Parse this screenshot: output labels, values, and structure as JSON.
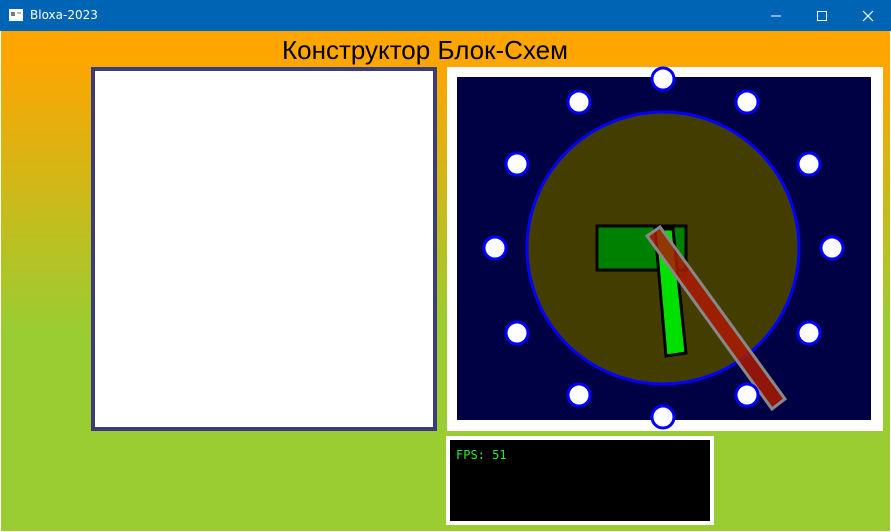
{
  "window": {
    "title": "Bloxa-2023",
    "titlebar_color": "#0064b4",
    "controls": [
      "minimize-icon",
      "maximize-icon",
      "close-icon"
    ]
  },
  "app": {
    "heading": "Конструктор Блок-Схем",
    "background_top_color": "#ffa500",
    "background_bottom_color": "#9acd32"
  },
  "block_panel": {
    "background_color": "#ffffff",
    "border_color": "#3c3c78"
  },
  "scene": {
    "background_color": "#000044",
    "circle_fill": "#443d00",
    "circle_stroke": "#0000ff",
    "handle_count": 12,
    "handle_fill": "#ffffff",
    "handle_stroke": "#0000ff",
    "blocks": [
      {
        "name": "dark-green-block",
        "color": "#008000"
      },
      {
        "name": "light-green-block",
        "color": "#00e000"
      },
      {
        "name": "red-bar",
        "color": "#aa1a00"
      }
    ]
  },
  "console": {
    "fps_text": "FPS: 51",
    "text_color": "#32e632"
  }
}
